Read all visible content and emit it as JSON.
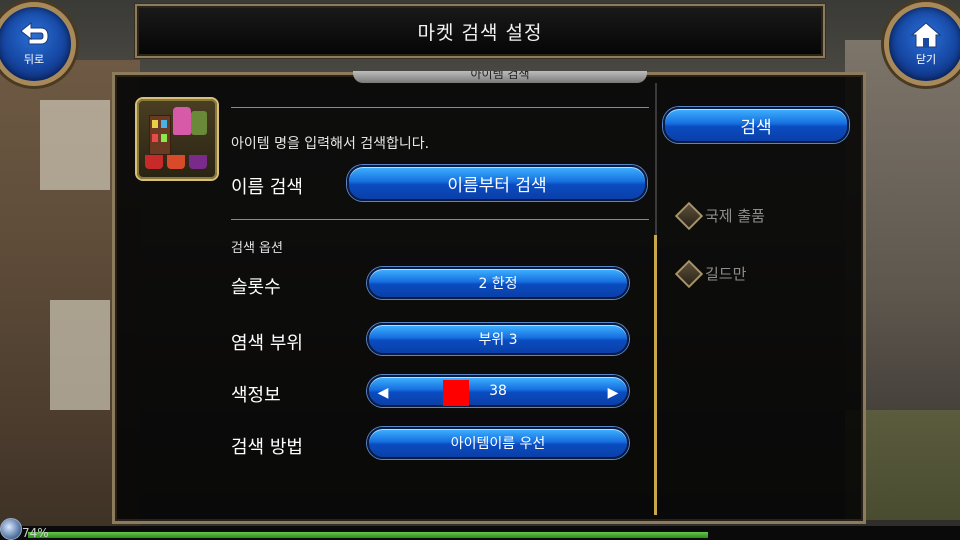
{
  "header": {
    "title": "마켓 검색 설정",
    "back_label": "뒤로",
    "close_label": "닫기"
  },
  "panel": {
    "top_tab_label": "아이템 검색",
    "hint": "아이템 명을 입력해서 검색합니다.",
    "name_search_label": "이름 검색",
    "name_search_button": "이름부터 검색",
    "options_heading": "검색 옵션",
    "rows": [
      {
        "label": "슬롯수",
        "value": "2 한정"
      },
      {
        "label": "염색 부위",
        "value": "부위 3"
      },
      {
        "label": "색정보",
        "value": "38"
      },
      {
        "label": "검색 방법",
        "value": "아이템이름 우선"
      }
    ],
    "color_swatch": "#ff0000"
  },
  "sidebar": {
    "search_button": "검색",
    "options": [
      {
        "label": "국제 출품"
      },
      {
        "label": "길드만"
      }
    ]
  },
  "status": {
    "hp_percent": "74%"
  },
  "icons": {
    "back": "back-arrow-icon",
    "close": "home-icon",
    "arrow_left": "left-arrow-icon",
    "arrow_right": "right-arrow-icon",
    "diamond": "diamond-icon",
    "item": "shop-item-icon"
  }
}
